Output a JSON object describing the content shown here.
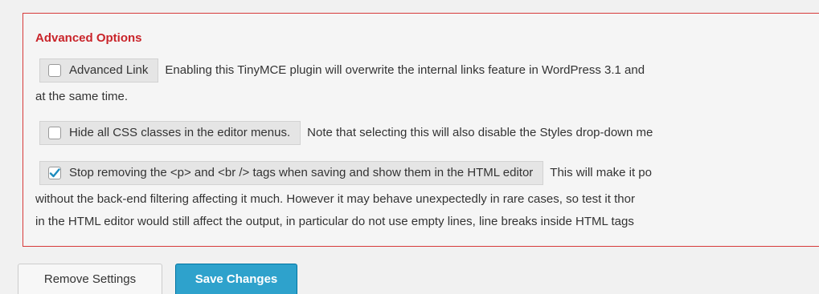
{
  "advanced_options": {
    "title": "Advanced Options",
    "options": [
      {
        "label": "Advanced Link",
        "checked": false,
        "description_lines": [
          "Enabling this TinyMCE plugin will overwrite the internal links feature in WordPress 3.1 and",
          "at the same time."
        ]
      },
      {
        "label": "Hide all CSS classes in the editor menus.",
        "checked": false,
        "description_lines": [
          "Note that selecting this will also disable the Styles drop-down me"
        ]
      },
      {
        "label": "Stop removing the <p> and <br /> tags when saving and show them in the HTML editor",
        "checked": true,
        "description_lines": [
          "This will make it po",
          "without the back-end filtering affecting it much. However it may behave unexpectedly in rare cases, so test it thor",
          "in the HTML editor would still affect the output, in particular do not use empty lines, line breaks inside HTML tags"
        ]
      }
    ]
  },
  "buttons": {
    "remove_label": "Remove Settings",
    "save_label": "Save Changes"
  },
  "colors": {
    "accent_red": "#c9242a",
    "primary_blue": "#2ea2cc"
  }
}
